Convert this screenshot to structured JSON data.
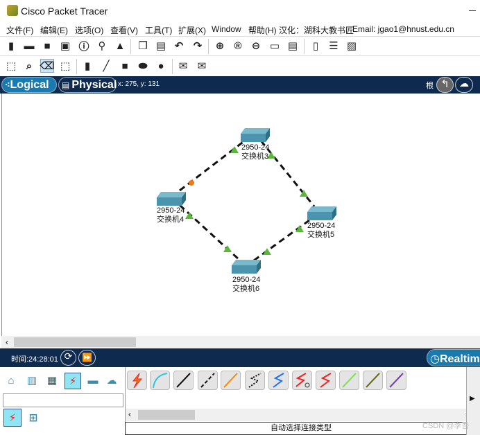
{
  "window": {
    "title": "Cisco Packet Tracer"
  },
  "menu": [
    "文件(F)",
    "编辑(E)",
    "选项(O)",
    "查看(V)",
    "工具(T)",
    "扩展(X)",
    "Window",
    "帮助(H)",
    "汉化：湖科大教书匠",
    "Email: jgao1@hnust.edu.cn"
  ],
  "toolbar_main": [
    "new-file",
    "open-folder",
    "save",
    "print",
    "info",
    "network-wizard",
    "activity-wizard",
    "copy",
    "paste",
    "undo",
    "redo",
    "zoom-in",
    "zoom-reset",
    "zoom-out",
    "drawing-palette",
    "custom-device-dialog",
    "viewport",
    "device-template",
    "screenshot"
  ],
  "toolbar_draw": [
    "select",
    "inspect",
    "delete",
    "resize-shape",
    "note",
    "line",
    "rectangle",
    "ellipse",
    "freeform",
    "simple-pdu",
    "complex-pdu"
  ],
  "nav": {
    "logical": "Logical",
    "physical": "Physical",
    "coords": "x: 275, y: 131",
    "root": "根"
  },
  "devices": [
    {
      "model": "2950-24",
      "name": "交换机3"
    },
    {
      "model": "2950-24",
      "name": "交换机4"
    },
    {
      "model": "2950-24",
      "name": "交换机5"
    },
    {
      "model": "2950-24",
      "name": "交换机6"
    }
  ],
  "link_status_colors": {
    "up": "#5cb83c",
    "blocking": "#f07a10"
  },
  "time": {
    "label": "时间:24:28:01",
    "mode": "Realtime"
  },
  "cables": [
    "automatic",
    "console",
    "copper-straight",
    "copper-cross",
    "fiber",
    "phone",
    "coaxial",
    "serial-dce",
    "serial-dte",
    "octal",
    "iot",
    "usb"
  ],
  "status": {
    "connection_type": "自动选择连接类型"
  },
  "watermark": "CSDN @李吾"
}
